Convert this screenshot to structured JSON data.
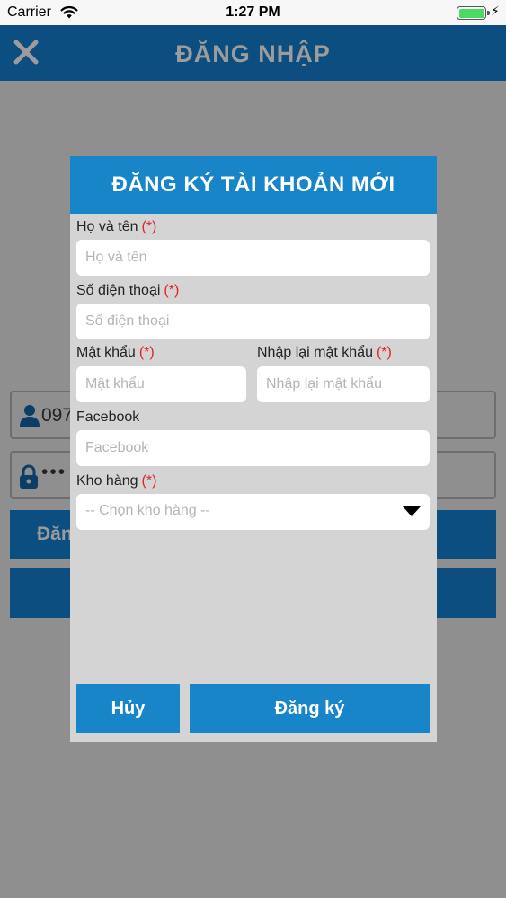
{
  "status_bar": {
    "carrier": "Carrier",
    "time": "1:27 PM",
    "battery_level": 1.0,
    "icons": [
      "wifi-icon",
      "battery-icon",
      "charging-bolt-icon"
    ]
  },
  "header": {
    "title": "ĐĂNG NHẬP",
    "close_icon": "close-icon"
  },
  "background_form": {
    "phone_value": "097",
    "password_value": "•••",
    "login_button_label": "Đăn"
  },
  "modal": {
    "title": "ĐĂNG KÝ TÀI KHOẢN MỚI",
    "required_marker": "(*)",
    "fields": {
      "fullname": {
        "label": "Họ và tên",
        "placeholder": "Họ và tên"
      },
      "phone": {
        "label": "Số điện thoại",
        "placeholder": "Số điện thoại"
      },
      "password": {
        "label": "Mật khẩu",
        "placeholder": "Mật khẩu"
      },
      "confirm_password": {
        "label": "Nhập lại mật khẩu",
        "placeholder": "Nhập lại mật khẩu"
      },
      "facebook": {
        "label": "Facebook",
        "placeholder": "Facebook"
      },
      "warehouse": {
        "label": "Kho hàng",
        "placeholder": "-- Chọn kho hàng --"
      }
    },
    "cancel_label": "Hủy",
    "submit_label": "Đăng ký"
  },
  "colors": {
    "accent": "#1785c8",
    "header_dim": "#0b4e7f",
    "overlay": "#8f8f8f",
    "modal_bg": "#d4d4d4",
    "required": "#e02424"
  }
}
